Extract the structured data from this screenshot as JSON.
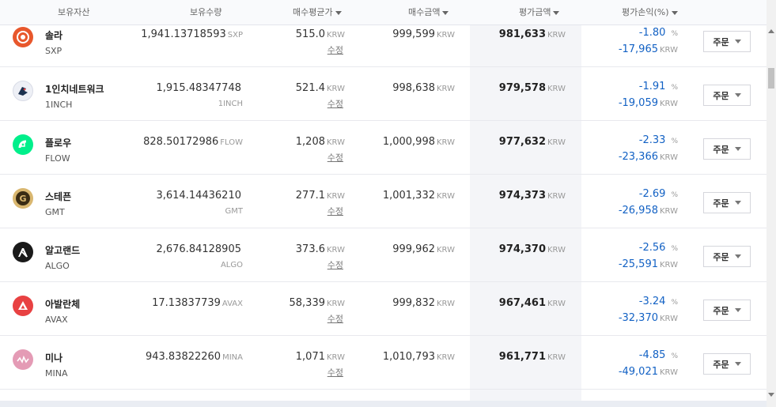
{
  "header": {
    "asset": "보유자산",
    "qty": "보유수량",
    "avg_price": "매수평균가",
    "buy_amount": "매수금액",
    "eval_amount": "평가금액",
    "pl": "평가손익(%)"
  },
  "units": {
    "krw": "KRW",
    "percent": "%"
  },
  "edit_label": "수정",
  "order_label": "주문",
  "rows": [
    {
      "name": "솔라",
      "symbol": "SXP",
      "qty": "1,941.13718593",
      "qty_unit": "SXP",
      "qty_unit_inline": true,
      "avg": "515.0",
      "buy": "999,599",
      "val": "981,633",
      "rate": "-1.80",
      "pl": "-17,965",
      "icon": "sxp-icon",
      "icon_color": "#e8572c"
    },
    {
      "name": "1인치네트워크",
      "symbol": "1INCH",
      "qty": "1,915.48347748",
      "qty_unit": "1INCH",
      "qty_unit_inline": false,
      "avg": "521.4",
      "buy": "998,638",
      "val": "979,578",
      "rate": "-1.91",
      "pl": "-19,059",
      "icon": "1inch-icon",
      "icon_color": "#1b314f"
    },
    {
      "name": "플로우",
      "symbol": "FLOW",
      "qty": "828.50172986",
      "qty_unit": "FLOW",
      "qty_unit_inline": true,
      "avg": "1,208",
      "buy": "1,000,998",
      "val": "977,632",
      "rate": "-2.33",
      "pl": "-23,366",
      "icon": "flow-icon",
      "icon_color": "#00ef8b"
    },
    {
      "name": "스테픈",
      "symbol": "GMT",
      "qty": "3,614.14436210",
      "qty_unit": "GMT",
      "qty_unit_inline": false,
      "avg": "277.1",
      "buy": "1,001,332",
      "val": "974,373",
      "rate": "-2.69",
      "pl": "-26,958",
      "icon": "gmt-icon",
      "icon_color": "#d9b770"
    },
    {
      "name": "알고랜드",
      "symbol": "ALGO",
      "qty": "2,676.84128905",
      "qty_unit": "ALGO",
      "qty_unit_inline": false,
      "avg": "373.6",
      "buy": "999,962",
      "val": "974,370",
      "rate": "-2.56",
      "pl": "-25,591",
      "icon": "algo-icon",
      "icon_color": "#1a1a1a"
    },
    {
      "name": "아발란체",
      "symbol": "AVAX",
      "qty": "17.13837739",
      "qty_unit": "AVAX",
      "qty_unit_inline": true,
      "avg": "58,339",
      "buy": "999,832",
      "val": "967,461",
      "rate": "-3.24",
      "pl": "-32,370",
      "icon": "avax-icon",
      "icon_color": "#e84142"
    },
    {
      "name": "미나",
      "symbol": "MINA",
      "qty": "943.83822260",
      "qty_unit": "MINA",
      "qty_unit_inline": true,
      "avg": "1,071",
      "buy": "1,010,793",
      "val": "961,771",
      "rate": "-4.85",
      "pl": "-49,021",
      "icon": "mina-icon",
      "icon_color": "#e49bb5"
    }
  ]
}
